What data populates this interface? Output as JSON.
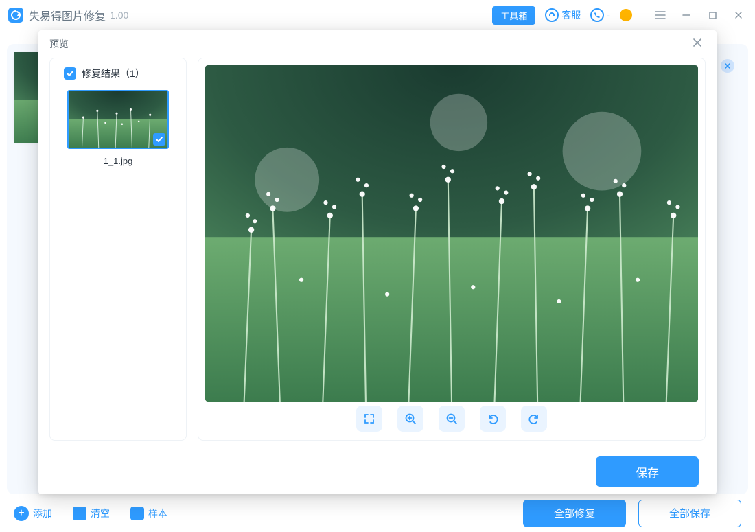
{
  "app": {
    "title": "失易得图片修复",
    "version": "1.00"
  },
  "titlebar": {
    "toolbox": "工具箱",
    "support": "客服",
    "phone_dash": "-"
  },
  "bottombar": {
    "add": "添加",
    "clear": "清空",
    "sample": "样本",
    "repair_all": "全部修复",
    "save_all": "全部保存"
  },
  "modal": {
    "title": "预览",
    "side_title": "修复结果（1）",
    "thumbnails": [
      {
        "name": "1_1.jpg",
        "selected": true
      }
    ],
    "save": "保存"
  }
}
